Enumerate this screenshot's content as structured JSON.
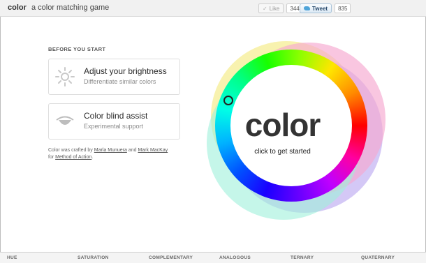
{
  "app": {
    "name": "color",
    "tagline": "a color matching game"
  },
  "social": {
    "like_label": "Like",
    "like_count": "344",
    "tweet_label": "Tweet",
    "tweet_count": "835"
  },
  "panel": {
    "heading": "BEFORE YOU START",
    "cards": [
      {
        "title": "Adjust your brightness",
        "subtitle": "Differentiate similar colors",
        "icon": "sun-icon"
      },
      {
        "title": "Color blind assist",
        "subtitle": "Experimental support",
        "icon": "eye-icon"
      }
    ],
    "credits": {
      "prefix": "Color was crafted by",
      "author1": "Marla Munuera",
      "and": "and",
      "author2": "Mark MacKay",
      "for": "for",
      "org": "Method of Action",
      "suffix": "."
    }
  },
  "wheel": {
    "logo": "color",
    "cta": "click to get started",
    "colors": {
      "yellow_halo": "#f7f1a6",
      "pink_halo": "#f6a7cf",
      "teal_halo": "#9ef0db",
      "violet_halo": "#c6b6f3"
    }
  },
  "tabs": [
    "HUE",
    "SATURATION",
    "COMPLEMENTARY",
    "ANALOGOUS",
    "TERNARY",
    "QUATERNARY"
  ]
}
